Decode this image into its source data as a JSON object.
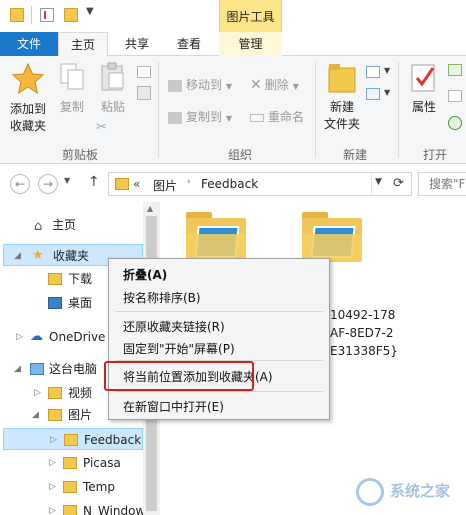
{
  "ribbon": {
    "tabs": [
      "文件",
      "主页",
      "共享",
      "查看",
      "管理"
    ],
    "context_tab": "图片工具",
    "groups": {
      "clipboard": "剪贴板",
      "organize": "组织",
      "new": "新建",
      "open": "打开"
    },
    "buttons": {
      "pin_favorites_line1": "添加到",
      "pin_favorites_line2": "收藏夹",
      "copy": "复制",
      "paste": "粘贴",
      "move_to": "移动到",
      "copy_to": "复制到",
      "delete": "删除",
      "rename": "重命名",
      "new_folder_line1": "新建",
      "new_folder_line2": "文件夹",
      "properties": "属性"
    }
  },
  "address": {
    "chevrons": "«",
    "path": [
      "图片",
      "Feedback"
    ],
    "search_placeholder": "搜索\"F"
  },
  "nav": {
    "items": [
      "主页",
      "收藏夹",
      "下载",
      "桌面",
      "OneDrive",
      "这台电脑",
      "视频",
      "图片",
      "Feedback",
      "Picasa",
      "Temp",
      "N_Window"
    ]
  },
  "content": {
    "file2_lines": [
      "10492-178",
      "AF-8ED7-2",
      "E31338F5}"
    ]
  },
  "context_menu": {
    "items": [
      "折叠(A)",
      "按名称排序(B)",
      "还原收藏夹链接(R)",
      "固定到\"开始\"屏幕(P)",
      "将当前位置添加到收藏夹(A)",
      "在新窗口中打开(E)"
    ]
  },
  "watermark": "系统之家",
  "colors": {
    "file_tab": "#1979ca",
    "context_tab": "#fde68a",
    "selection": "#cce8ff",
    "highlight_box": "#d21f1f"
  }
}
